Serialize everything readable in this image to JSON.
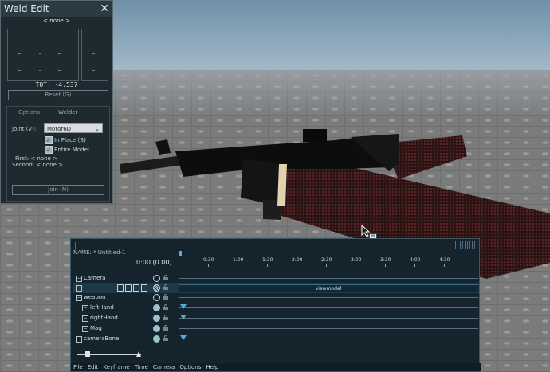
{
  "weld_edit": {
    "title": "Weld Edit",
    "close": "✕",
    "part_name": "< none >",
    "tot": "TOT: -4.537",
    "reset_label": "Reset (G)",
    "tabs": [
      "Options",
      "Welder"
    ],
    "joint_label": "Joint (V):",
    "joint_value": "Motor6D",
    "in_place": "In Place (B)",
    "entire_model": "Entire Model",
    "first": "First: < none >",
    "second": "Second: < none >",
    "join_label": "Join (N)"
  },
  "timeline": {
    "name": "NAME: * Untitled-1",
    "time": "0:00 (0.00)",
    "ruler": [
      "0:30",
      "1:00",
      "1:30",
      "2:00",
      "2:30",
      "3:00",
      "3:30",
      "4:00",
      "4:30"
    ],
    "rows": [
      {
        "label": "Camera",
        "indent": 0,
        "toggle": "−"
      },
      {
        "label": "",
        "indent": 0,
        "toggle": "−",
        "bar": "viewmodel"
      },
      {
        "label": "weapon",
        "indent": 0,
        "toggle": "−"
      },
      {
        "label": "leftHand",
        "indent": 1,
        "toggle": "−"
      },
      {
        "label": "rightHand",
        "indent": 1,
        "toggle": "−"
      },
      {
        "label": "Mag",
        "indent": 1,
        "toggle": "−"
      },
      {
        "label": "cameraBone",
        "indent": 0,
        "toggle": "−"
      }
    ],
    "menu": [
      "File",
      "Edit",
      "Keyframe",
      "Time",
      "Camera",
      "Options",
      "Help"
    ]
  },
  "cursor_badge": "W",
  "colors": {
    "accent": "#5ea9d6",
    "panel": "#1f2a30",
    "timeline_bg": "#14232c"
  }
}
